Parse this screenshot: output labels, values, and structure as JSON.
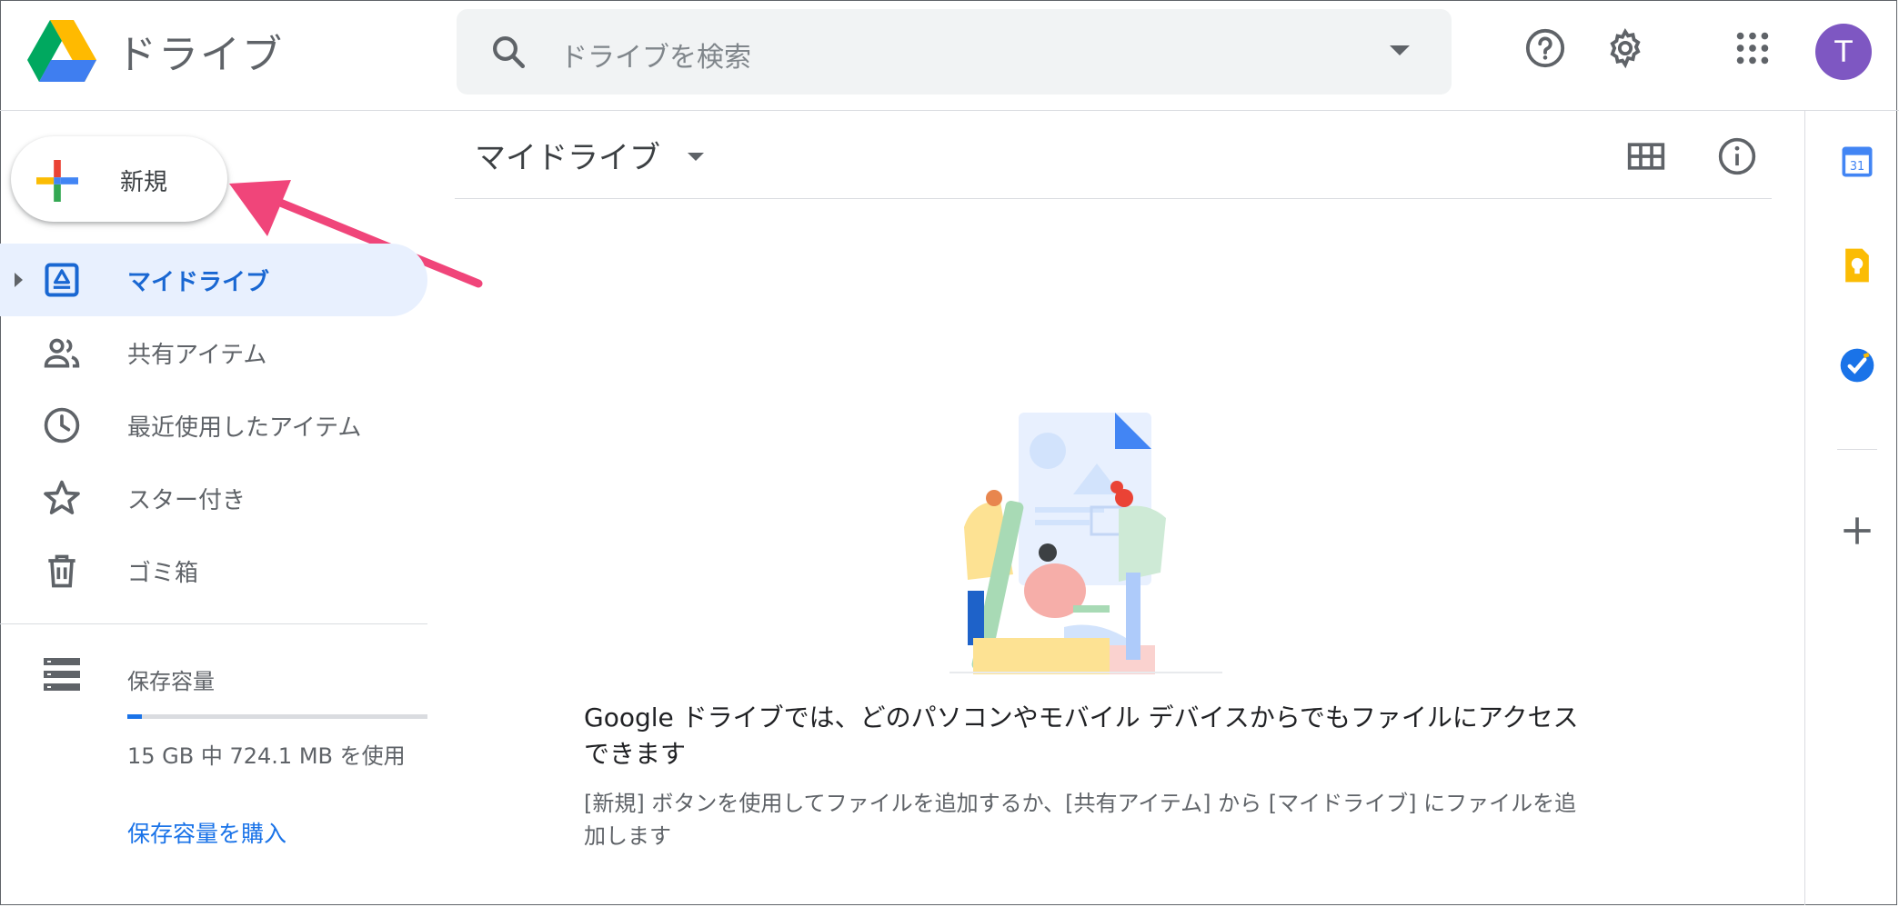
{
  "app": {
    "title": "ドライブ"
  },
  "search": {
    "placeholder": "ドライブを検索"
  },
  "header": {
    "avatar_initial": "T"
  },
  "new_button": {
    "label": "新規"
  },
  "sidebar": {
    "items": [
      {
        "label": "マイドライブ",
        "icon": "my-drive-icon",
        "active": true
      },
      {
        "label": "共有アイテム",
        "icon": "people-icon"
      },
      {
        "label": "最近使用したアイテム",
        "icon": "clock-icon"
      },
      {
        "label": "スター付き",
        "icon": "star-icon"
      },
      {
        "label": "ゴミ箱",
        "icon": "trash-icon"
      }
    ],
    "storage": {
      "label": "保存容量",
      "usage_text": "15 GB 中 724.1 MB を使用",
      "used_fraction": 0.047,
      "buy_label": "保存容量を購入"
    }
  },
  "main": {
    "title": "マイドライブ",
    "empty_title": "Google ドライブでは、どのパソコンやモバイル デバイスからでもファイルにアクセスできます",
    "empty_subtitle": "[新規] ボタンを使用してファイルを追加するか、[共有アイテム] から [マイドライブ] にファイルを追加します"
  },
  "colors": {
    "accent": "#1a73e8",
    "active_bg": "#e8f0fe",
    "avatar": "#7e57c2",
    "annotation_arrow": "#f0457a"
  }
}
